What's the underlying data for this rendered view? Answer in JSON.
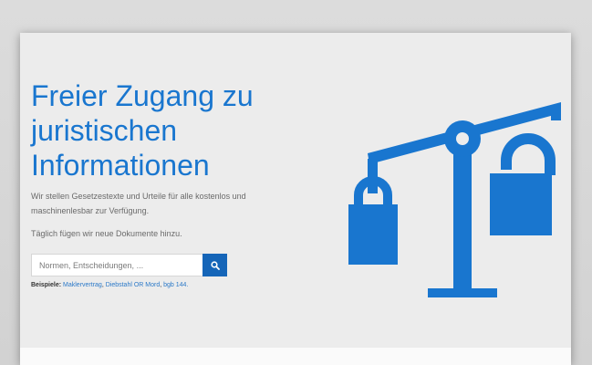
{
  "hero": {
    "title_lines": [
      "Freier Zugang zu",
      "juristischen",
      "Informationen"
    ],
    "lead": "Wir stellen Gesetzestexte und Urteile für alle kostenlos und maschinenlesbar zur Verfügung.",
    "daily": "Täglich fügen wir neue Dokumente hinzu."
  },
  "search": {
    "placeholder": "Normen, Entscheidungen, ...",
    "button_icon": "search-icon"
  },
  "examples": {
    "label": "Beispiele:",
    "items": [
      "Maklervertrag",
      "Diebstahl OR Mord",
      "bgb 144"
    ],
    "separator": ", ",
    "terminator": "."
  },
  "illustration": {
    "icon": "scales-of-justice-icon",
    "color": "#1976cf"
  },
  "colors": {
    "accent": "#1976cf",
    "button": "#1565b8",
    "card_background": "#ececec"
  }
}
